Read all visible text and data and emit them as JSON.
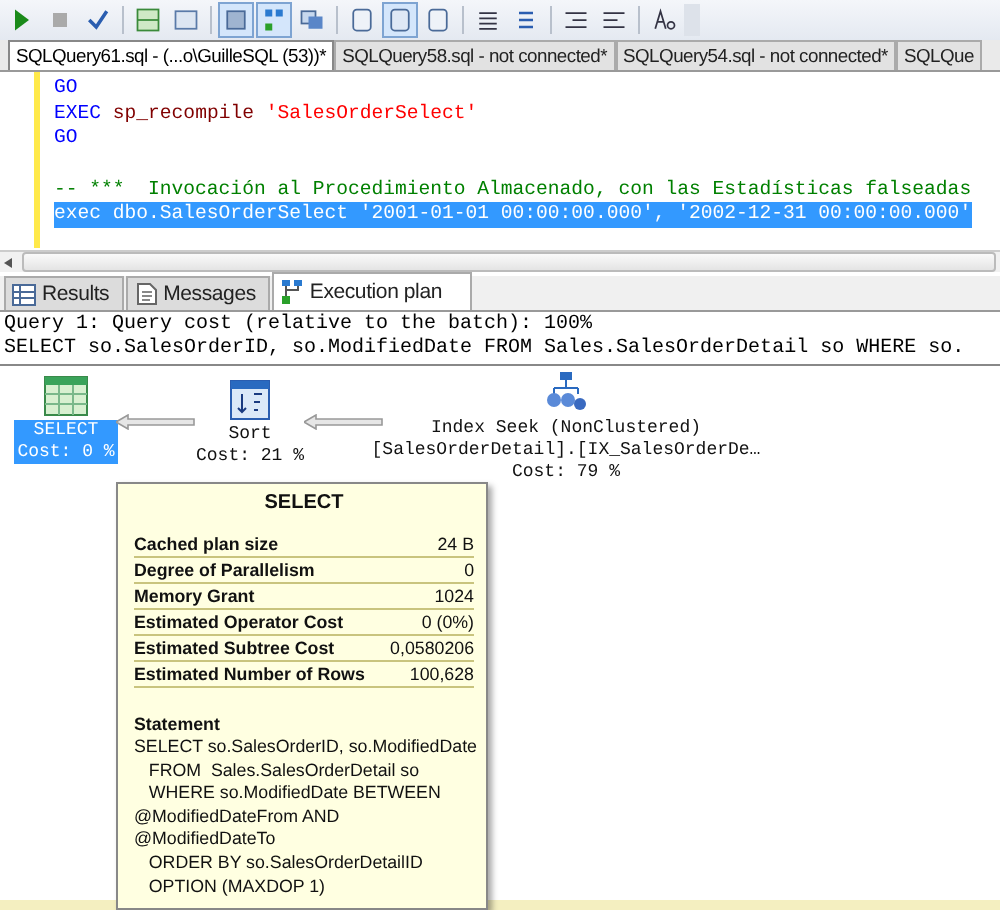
{
  "toolbar": [
    {
      "pressed": false
    },
    {
      "pressed": false
    },
    {
      "pressed": false
    },
    {
      "pressed": false
    },
    {
      "pressed": false
    },
    {
      "pressed": true
    },
    {
      "pressed": true
    },
    {
      "pressed": false
    },
    {
      "pressed": false
    },
    {
      "pressed": true
    },
    {
      "pressed": false
    },
    {
      "pressed": false
    },
    {
      "pressed": false
    },
    {
      "pressed": false
    },
    {
      "pressed": false
    },
    {
      "pressed": false
    }
  ],
  "document_tabs": [
    {
      "label": "SQLQuery61.sql - (...o\\GuilleSQL (53))*",
      "selected": true
    },
    {
      "label": "SQLQuery58.sql - not connected*",
      "selected": false
    },
    {
      "label": "SQLQuery54.sql - not connected*",
      "selected": false
    },
    {
      "label": "SQLQue",
      "selected": false
    }
  ],
  "editor": {
    "lines": [
      {
        "selected": false,
        "tokens": [
          {
            "kind": "keyword",
            "text": "GO"
          }
        ]
      },
      {
        "selected": false,
        "tokens": [
          {
            "kind": "keyword",
            "text": "EXEC"
          },
          {
            "kind": "system",
            "text": " sp_recompile "
          },
          {
            "kind": "string",
            "text": "'SalesOrderSelect'"
          }
        ]
      },
      {
        "selected": false,
        "tokens": [
          {
            "kind": "keyword",
            "text": "GO"
          }
        ]
      },
      {
        "selected": false
      },
      {
        "selected": false,
        "tokens": [
          {
            "kind": "comment",
            "text": "-- ***  Invocación al Procedimiento Almacenado, con las Estadísticas falseadas"
          }
        ]
      },
      {
        "selected": true,
        "tokens": [
          {
            "kind": "plain",
            "text": "exec dbo.SalesOrderSelect '2001-01-01 00:00:00.000', '2002-12-31 00:00:00.000'"
          }
        ]
      }
    ]
  },
  "result_tabs": [
    {
      "label": "Results",
      "kind": "grid",
      "selected": false
    },
    {
      "label": "Messages",
      "kind": "messages",
      "selected": false
    },
    {
      "label": "Execution plan",
      "kind": "plan",
      "selected": true
    }
  ],
  "plan": {
    "query_header": "Query 1: Query cost (relative to the batch): 100%",
    "query_text": "SELECT so.SalesOrderID, so.ModifiedDate FROM Sales.SalesOrderDetail so WHERE so.",
    "nodes": [
      {
        "kind": "select",
        "lines": [
          "SELECT",
          "Cost: 0 %"
        ],
        "selected": true
      },
      {
        "kind": "sort",
        "lines": [
          "Sort",
          "Cost: 21 %"
        ],
        "selected": false
      },
      {
        "kind": "index_seek",
        "lines": [
          "Index Seek (NonClustered)",
          "[SalesOrderDetail].[IX_SalesOrderDe…",
          "Cost: 79 %"
        ],
        "selected": false
      }
    ],
    "tooltip": {
      "title": "SELECT",
      "rows": [
        {
          "label": "Cached plan size",
          "value": "24 B"
        },
        {
          "label": "Degree of Parallelism",
          "value": "0"
        },
        {
          "label": "Memory Grant",
          "value": "1024"
        },
        {
          "label": "Estimated Operator Cost",
          "value": "0 (0%)"
        },
        {
          "label": "Estimated Subtree Cost",
          "value": "0,0580206"
        },
        {
          "label": "Estimated Number of Rows",
          "value": "100,628"
        }
      ],
      "statement_heading": "Statement",
      "statement_lines": [
        "SELECT so.SalesOrderID, so.ModifiedDate",
        "   FROM  Sales.SalesOrderDetail so",
        "   WHERE so.ModifiedDate BETWEEN",
        "@ModifiedDateFrom AND",
        "@ModifiedDateTo",
        "   ORDER BY so.SalesOrderDetailID",
        "   OPTION (MAXDOP 1)"
      ]
    }
  }
}
